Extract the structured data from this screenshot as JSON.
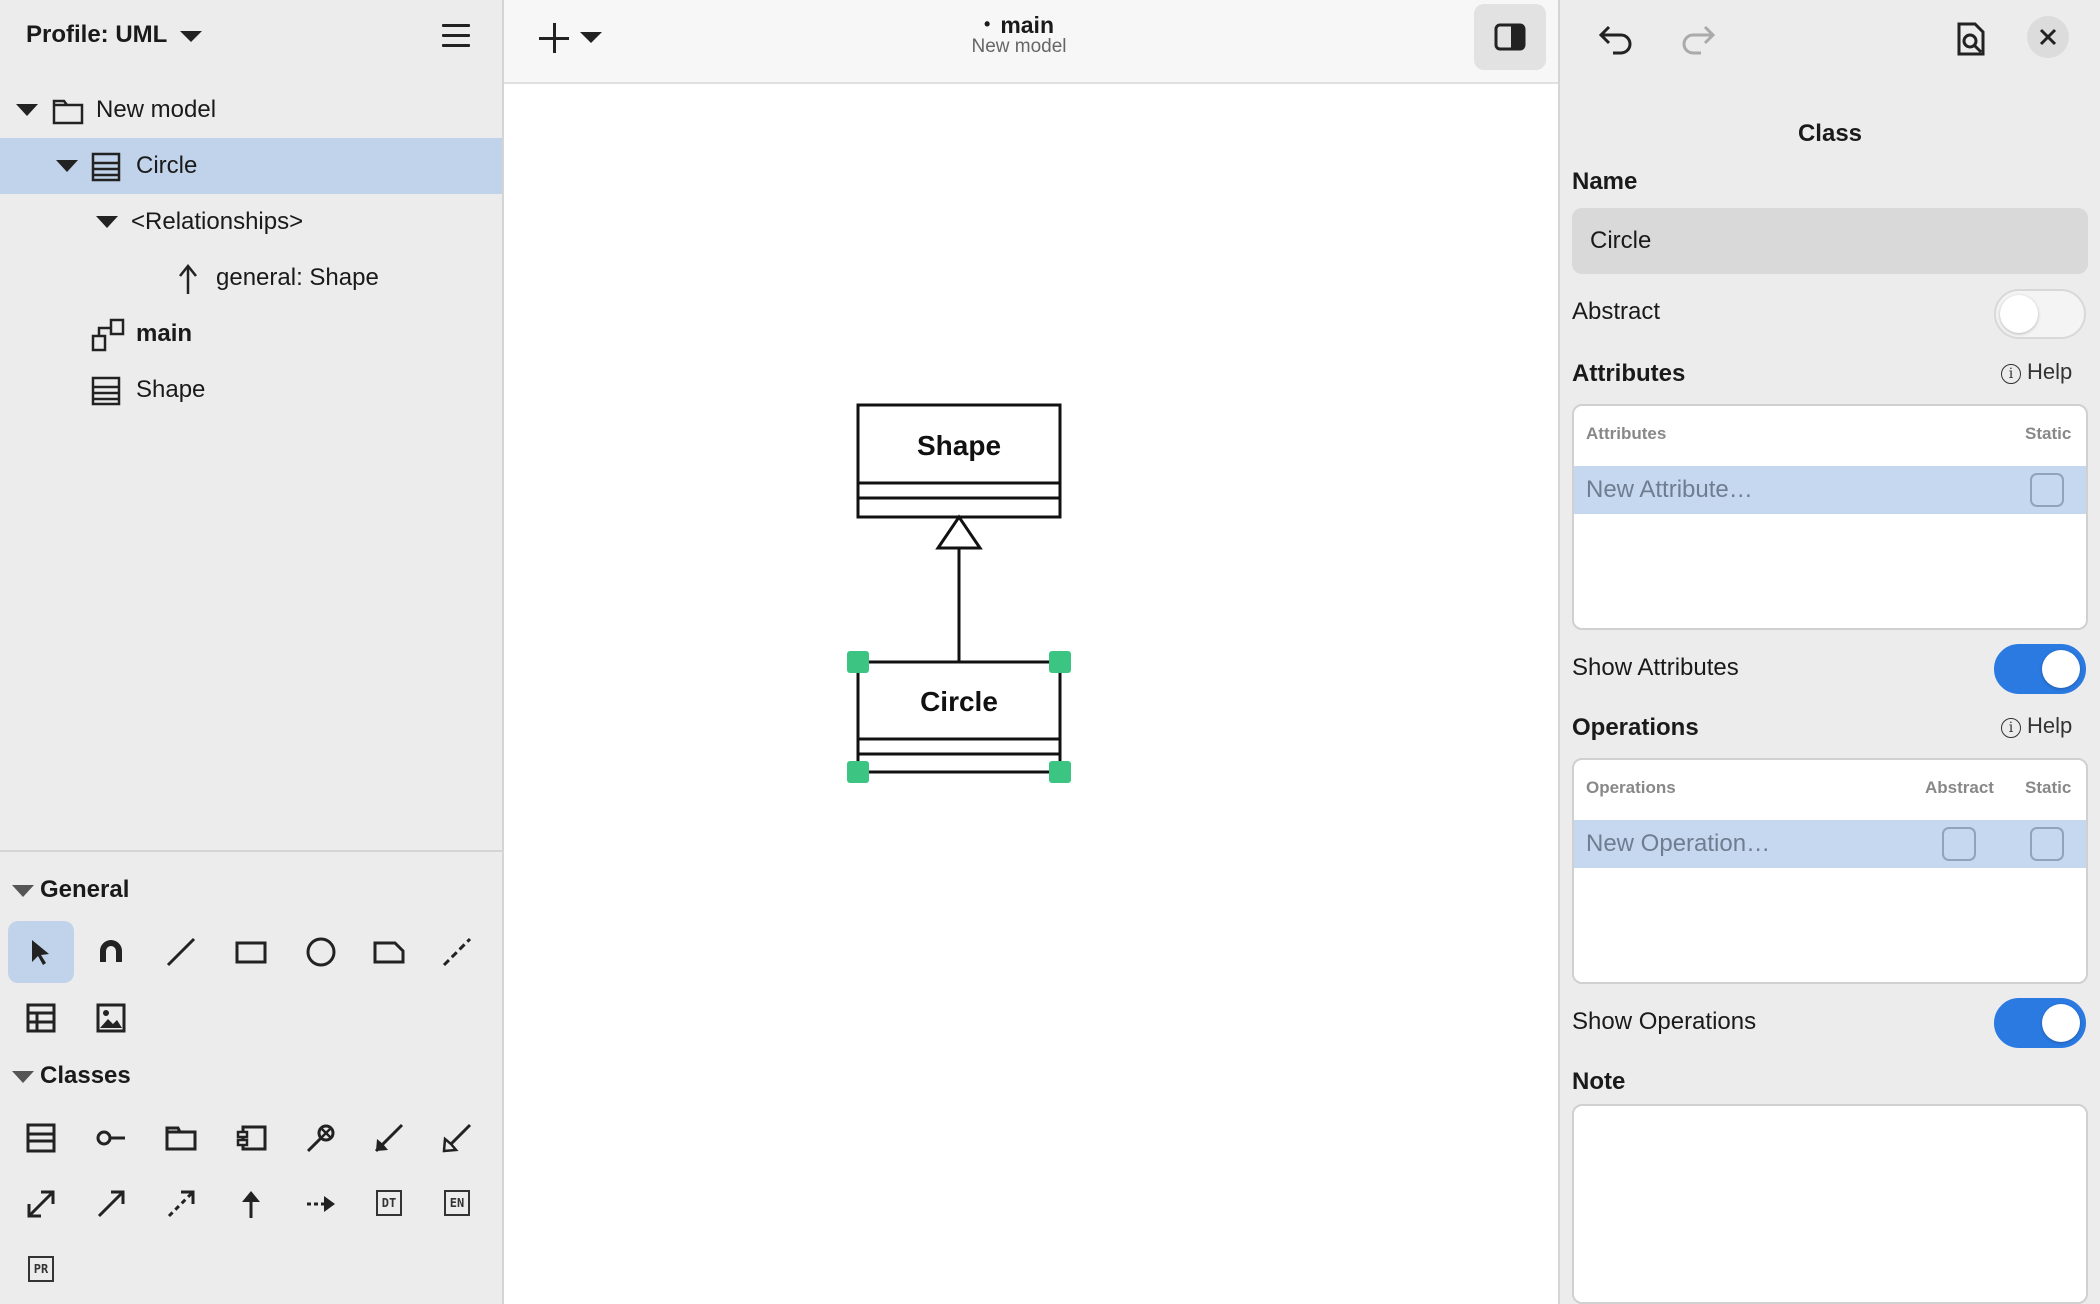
{
  "profile": {
    "label": "Profile: UML"
  },
  "tree": {
    "model": "New model",
    "circle": "Circle",
    "relationships": "<Relationships>",
    "general": "general: Shape",
    "main": "main",
    "shape": "Shape"
  },
  "palette": {
    "general_title": "General",
    "classes_title": "Classes",
    "tools_text": {
      "dt": "DT",
      "en": "EN",
      "pr": "PR"
    }
  },
  "canvas": {
    "diagram_name": "main",
    "model_name": "New model",
    "dot": "•",
    "classes": [
      {
        "name": "Shape"
      },
      {
        "name": "Circle"
      }
    ],
    "selection_color": "#3cc483"
  },
  "properties": {
    "title": "Class",
    "name_label": "Name",
    "name_value": "Circle",
    "abstract_label": "Abstract",
    "abstract_on": false,
    "attributes_label": "Attributes",
    "help": "Help",
    "attributes_col": "Attributes",
    "static_col": "Static",
    "new_attribute": "New Attribute…",
    "show_attributes_label": "Show Attributes",
    "show_attributes_on": true,
    "operations_label": "Operations",
    "operations_col": "Operations",
    "abstract_col": "Abstract",
    "new_operation": "New Operation…",
    "show_operations_label": "Show Operations",
    "show_operations_on": true,
    "note_label": "Note",
    "note_value": ""
  },
  "colors": {
    "accent": "#2a7ae2",
    "selection_row": "#c1d3ea",
    "handles": "#3cc483"
  }
}
